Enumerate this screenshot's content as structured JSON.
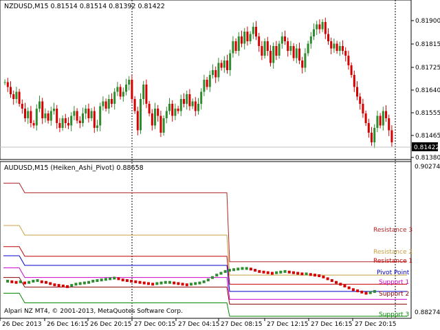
{
  "top_panel": {
    "header": "NZDUSD,M15  0.81514 0.81514 0.81392 0.81422",
    "price_ticks": [
      "0.81900",
      "0.81815",
      "0.81725",
      "0.81640",
      "0.81555",
      "0.81465",
      "0.81380"
    ],
    "current_price": "0.81422"
  },
  "bottom_panel": {
    "header": "AUDUSD,M15 (Heiken_Ashi_Pivot) 0.88658",
    "price_ticks": [
      "0.90274",
      "0.88274"
    ],
    "level_labels": {
      "resistance3": "Resistance 3",
      "resistance2": "Resistance 2",
      "resistance1": "Resistance 1",
      "pivot": "Pivot Point",
      "support1": "Support 1",
      "support2": "Support 2",
      "support3": "Support 3"
    },
    "copyright": "Alpari NZ MT4, © 2001-2013, MetaQuotes Software Corp."
  },
  "time_axis": [
    "26 Dec 2013",
    "26 Dec 16:15",
    "26 Dec 20:15",
    "27 Dec 00:15",
    "27 Dec 04:15",
    "27 Dec 08:15",
    "27 Dec 12:15",
    "27 Dec 16:15",
    "27 Dec 20:15"
  ],
  "colors": {
    "bull": "#2e8b2e",
    "bear": "#d40000",
    "resistance3": "#b22222",
    "resistance2": "#c8a040",
    "resistance1": "#c00000",
    "pivot": "#0000cc",
    "support1": "#cc00cc",
    "support2": "#8b0000",
    "support3": "#008800"
  },
  "chart_data": [
    {
      "type": "candlestick",
      "title": "NZDUSD,M15",
      "ylim": [
        0.8136,
        0.8196
      ],
      "closes": [
        0.8167,
        0.8165,
        0.8162,
        0.816,
        0.8163,
        0.8158,
        0.8156,
        0.8152,
        0.8155,
        0.815,
        0.8149,
        0.8156,
        0.8159,
        0.8152,
        0.8154,
        0.8151,
        0.8155,
        0.8156,
        0.815,
        0.8148,
        0.8152,
        0.815,
        0.8149,
        0.8153,
        0.8155,
        0.8151,
        0.815,
        0.8154,
        0.8156,
        0.8152,
        0.8155,
        0.8148,
        0.8149,
        0.8157,
        0.8159,
        0.8156,
        0.816,
        0.8158,
        0.8163,
        0.8165,
        0.8161,
        0.8163,
        0.8166,
        0.8168,
        0.816,
        0.8155,
        0.8147,
        0.816,
        0.8166,
        0.8158,
        0.8154,
        0.8149,
        0.8156,
        0.8153,
        0.8146,
        0.8152,
        0.8155,
        0.8158,
        0.8153,
        0.8156,
        0.8155,
        0.816,
        0.8158,
        0.8162,
        0.8157,
        0.8159,
        0.8155,
        0.8158,
        0.8163,
        0.8168,
        0.8165,
        0.817,
        0.8172,
        0.8169,
        0.8175,
        0.8173,
        0.8176,
        0.8172,
        0.8179,
        0.8184,
        0.818,
        0.8186,
        0.8183,
        0.8188,
        0.8184,
        0.8187,
        0.819,
        0.8186,
        0.8182,
        0.8178,
        0.8184,
        0.818,
        0.8175,
        0.8182,
        0.8178,
        0.8183,
        0.8186,
        0.8184,
        0.818,
        0.8182,
        0.8177,
        0.8181,
        0.8176,
        0.8173,
        0.8179,
        0.8183,
        0.8186,
        0.8189,
        0.8191,
        0.8189,
        0.8192,
        0.8187,
        0.8184,
        0.8181,
        0.8183,
        0.818,
        0.8182,
        0.818,
        0.8178,
        0.8174,
        0.817,
        0.8165,
        0.8161,
        0.8158,
        0.8154,
        0.815,
        0.8146,
        0.8142,
        0.8148,
        0.8153,
        0.8149,
        0.8155,
        0.8152,
        0.8147,
        0.8142
      ],
      "current": 0.81422
    },
    {
      "type": "line",
      "title": "AUDUSD,M15 (Heiken_Ashi_Pivot)",
      "ylim": [
        0.88,
        0.905
      ],
      "pivot_levels": {
        "resistance3": {
          "first": 0.902,
          "second": 0.889
        },
        "resistance2": {
          "first": 0.895,
          "second": 0.8868
        },
        "resistance1": {
          "first": 0.8915,
          "second": 0.8853
        },
        "pivot": {
          "first": 0.89,
          "second": 0.8841
        },
        "support1": {
          "first": 0.888,
          "second": 0.8828
        },
        "support2": {
          "first": 0.8864,
          "second": 0.882
        },
        "support3": {
          "first": 0.8838,
          "second": 0.88
        }
      },
      "ha_closes": [
        0.8858,
        0.8857,
        0.8856,
        0.8857,
        0.8855,
        0.8856,
        0.8858,
        0.8859,
        0.8857,
        0.8856,
        0.8854,
        0.8852,
        0.8851,
        0.885,
        0.8849,
        0.8851,
        0.8853,
        0.8854,
        0.8855,
        0.8856,
        0.8858,
        0.8859,
        0.886,
        0.8861,
        0.8862,
        0.8863,
        0.8862,
        0.886,
        0.8859,
        0.8858,
        0.8857,
        0.8856,
        0.8855,
        0.8854,
        0.8853,
        0.8854,
        0.8855,
        0.8856,
        0.8856,
        0.8855,
        0.8854,
        0.8853,
        0.8852,
        0.8853,
        0.8854,
        0.8855,
        0.8857,
        0.886,
        0.8864,
        0.8868,
        0.8871,
        0.8874,
        0.8876,
        0.8877,
        0.8878,
        0.8879,
        0.8879,
        0.8878,
        0.8876,
        0.8874,
        0.8873,
        0.8872,
        0.8871,
        0.8872,
        0.8873,
        0.8874,
        0.8873,
        0.8872,
        0.8871,
        0.887,
        0.887,
        0.8869,
        0.8868,
        0.8867,
        0.8865,
        0.8862,
        0.8859,
        0.8856,
        0.8853,
        0.885,
        0.8847,
        0.8844,
        0.8842,
        0.884,
        0.8838,
        0.8839,
        0.8841
      ],
      "current": 0.88658
    }
  ]
}
